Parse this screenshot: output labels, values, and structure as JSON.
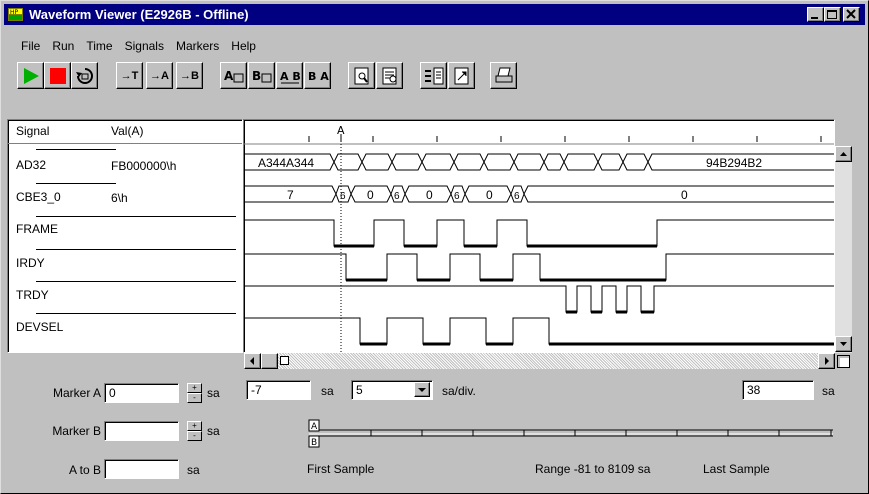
{
  "window": {
    "title": "Waveform Viewer (E2926B - Offline)"
  },
  "menu": [
    "File",
    "Run",
    "Time",
    "Signals",
    "Markers",
    "Help"
  ],
  "toolbar": {
    "goto_t": "→T",
    "goto_a": "→A",
    "goto_b": "→B",
    "marker_a": "A",
    "marker_b": "B",
    "marker_ab": "A B",
    "marker_b_a": "B A"
  },
  "signals": {
    "header_signal": "Signal",
    "header_val": "Val(A)",
    "rows": [
      {
        "name": "AD32",
        "value": "FB000000\\h"
      },
      {
        "name": "CBE3_0",
        "value": "6\\h"
      },
      {
        "name": "FRAME",
        "value": ""
      },
      {
        "name": "IRDY",
        "value": ""
      },
      {
        "name": "TRDY",
        "value": ""
      },
      {
        "name": "DEVSEL",
        "value": ""
      }
    ]
  },
  "waveform": {
    "marker_label": "A",
    "ad32_start": "A344A344",
    "ad32_end": "94B294B2",
    "cbe_start": "7",
    "cbe_short": "6",
    "cbe_mid": "0",
    "cbe_end": "0"
  },
  "markers": {
    "marker_a_label": "Marker A",
    "marker_a_value": "0",
    "marker_b_label": "Marker B",
    "marker_b_value": "",
    "a_to_b_label": "A to B",
    "a_to_b_value": "",
    "unit": "sa"
  },
  "view": {
    "start_value": "-7",
    "start_unit": "sa",
    "scale_value": "5",
    "scale_unit": "sa/div.",
    "end_value": "38",
    "end_unit": "sa"
  },
  "overview": {
    "marker_a": "A",
    "marker_b": "B",
    "first_sample": "First Sample",
    "range": "Range -81 to 8109 sa",
    "last_sample": "Last Sample"
  }
}
